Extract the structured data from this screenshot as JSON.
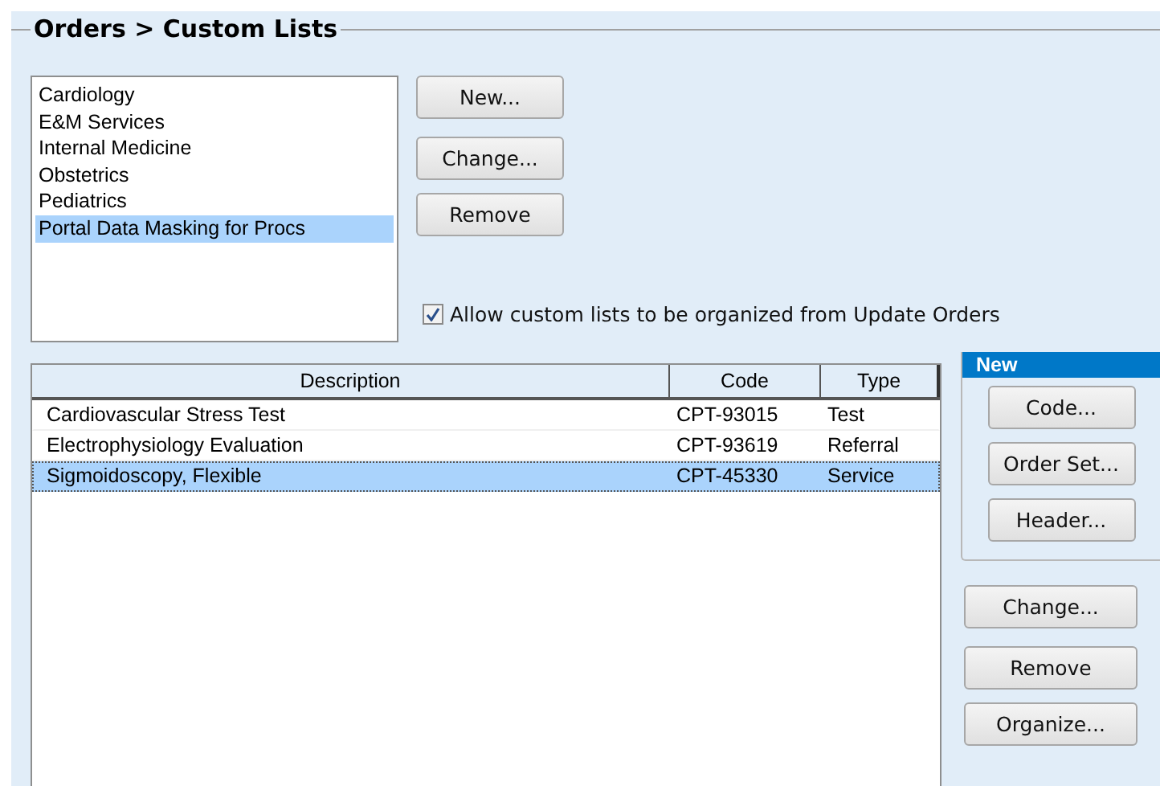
{
  "title": "Orders > Custom Lists",
  "lists": [
    {
      "label": "Cardiology",
      "selected": false
    },
    {
      "label": "E&M Services",
      "selected": false
    },
    {
      "label": "Internal Medicine",
      "selected": false
    },
    {
      "label": "Obstetrics",
      "selected": false
    },
    {
      "label": "Pediatrics",
      "selected": false
    },
    {
      "label": "Portal Data Masking for Procs",
      "selected": true
    }
  ],
  "list_buttons": [
    "New...",
    "Change...",
    "Remove"
  ],
  "allow_organize": {
    "label": "Allow custom lists to be organized from Update Orders",
    "checked": true
  },
  "table": {
    "columns": [
      "Description",
      "Code",
      "Type"
    ],
    "rows": [
      {
        "cells": [
          "Cardiovascular Stress Test",
          "CPT-93015",
          "Test"
        ],
        "selected": false
      },
      {
        "cells": [
          "Electrophysiology Evaluation",
          "CPT-93619",
          "Referral"
        ],
        "selected": false
      },
      {
        "cells": [
          "Sigmoidoscopy, Flexible",
          "CPT-45330",
          "Service"
        ],
        "selected": true
      }
    ]
  },
  "new_panel": {
    "title": "New",
    "buttons": [
      "Code...",
      "Order Set...",
      "Header..."
    ]
  },
  "item_buttons": [
    "Change...",
    "Remove",
    "Organize..."
  ]
}
